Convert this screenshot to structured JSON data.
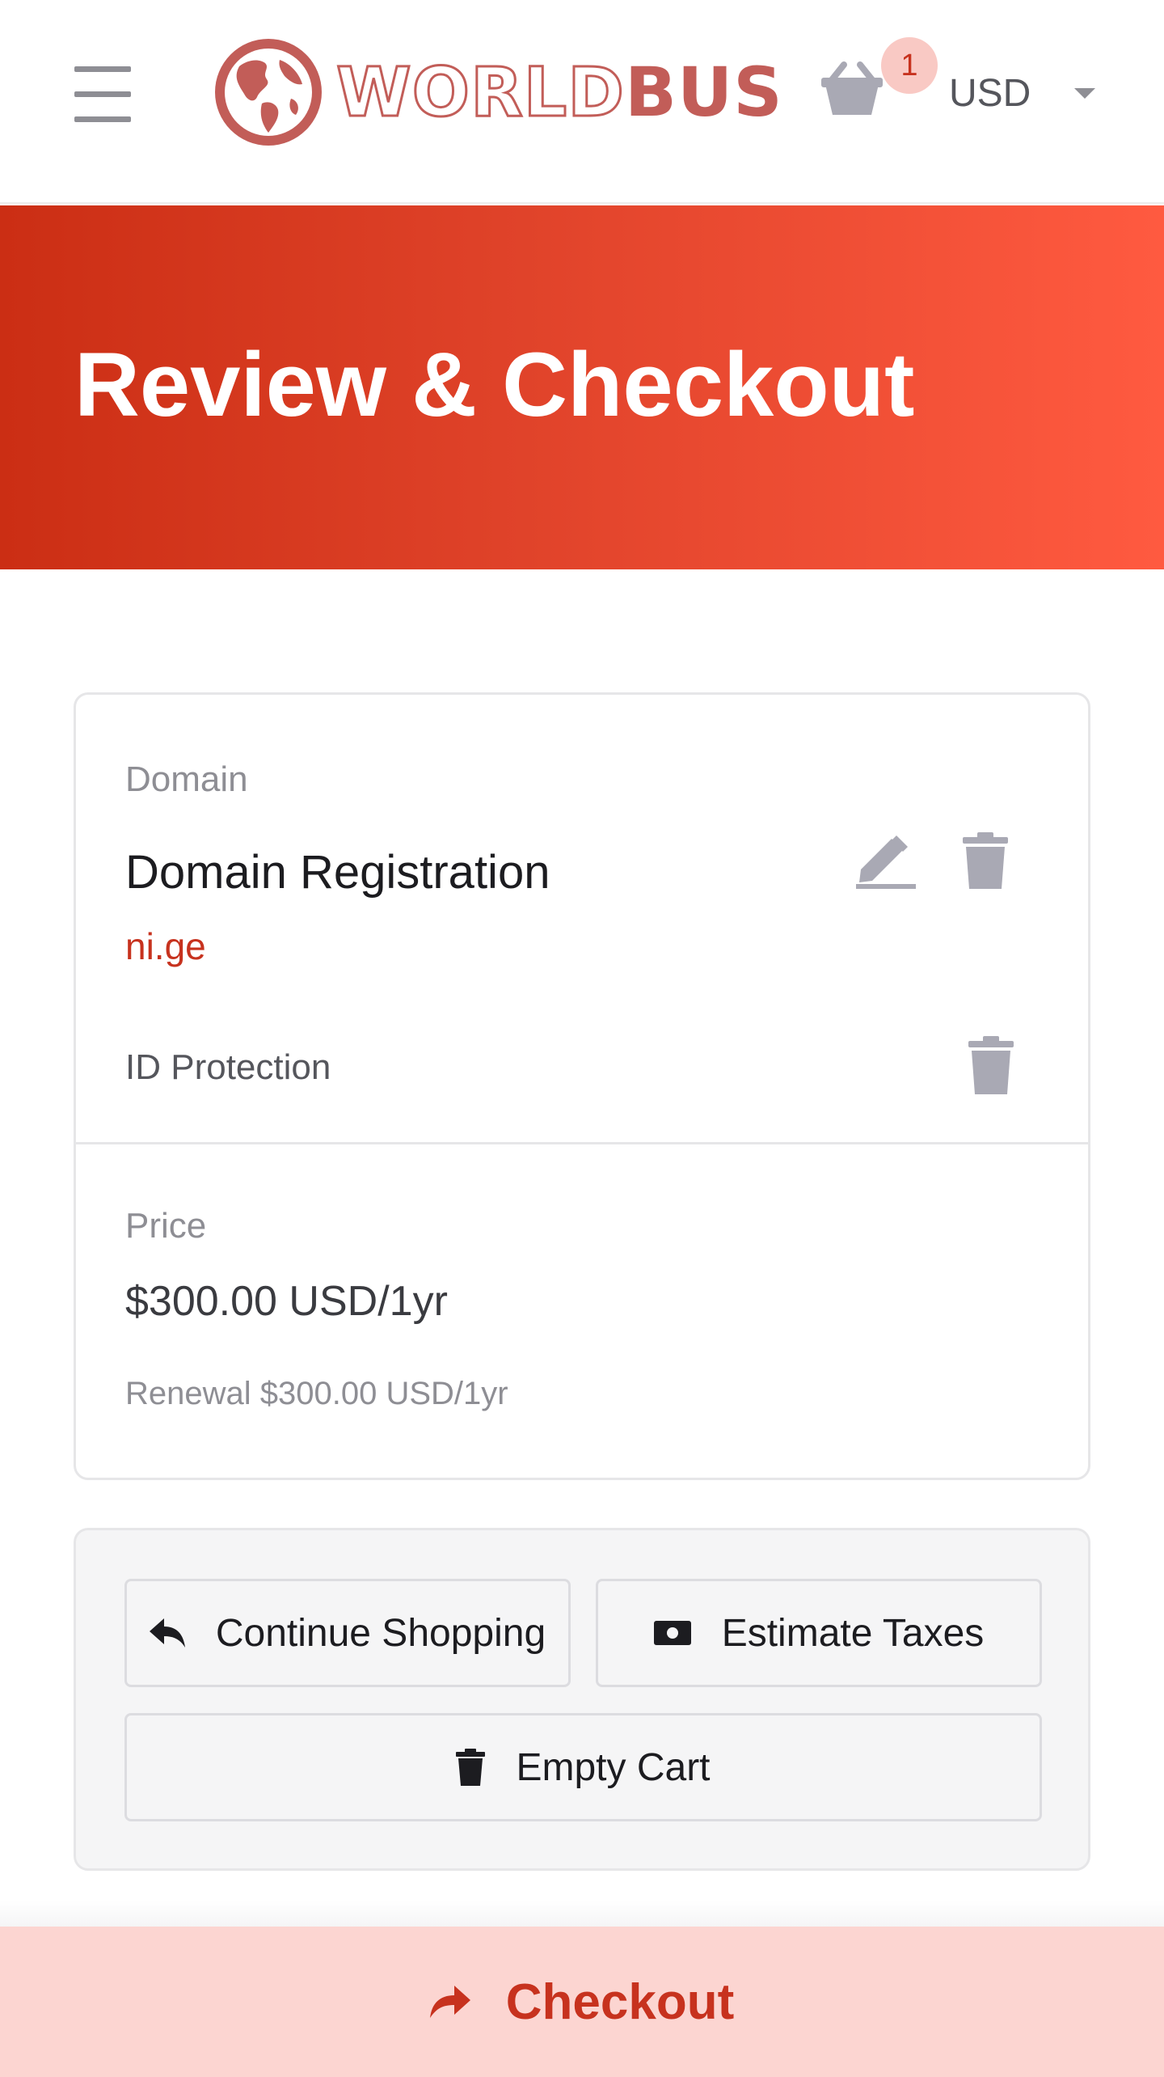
{
  "header": {
    "logo": {
      "word_light": "WORLD",
      "word_bold": "BUS",
      "brand_color": "#c25d58"
    },
    "cart": {
      "icon": "basket-icon",
      "count": "1"
    },
    "currency": {
      "selected": "USD"
    },
    "menu_icon": "hamburger-icon"
  },
  "hero": {
    "title": "Review & Checkout",
    "gradient_colors": [
      "#cb2e14",
      "#ff5a40"
    ]
  },
  "cart_item": {
    "type_label": "Domain",
    "title": "Domain Registration",
    "domain": "ni.ge",
    "edit_icon": "pencil-icon",
    "remove_icon": "trash-icon",
    "addon": {
      "label": "ID Protection",
      "remove_icon": "trash-icon"
    },
    "price_label": "Price",
    "price": "$300.00 USD/1yr",
    "renewal": "Renewal $300.00 USD/1yr"
  },
  "actions": {
    "continue_shopping": {
      "label": "Continue Shopping",
      "icon": "reply-arrow-icon"
    },
    "estimate_taxes": {
      "label": "Estimate Taxes",
      "icon": "money-bill-icon"
    },
    "empty_cart": {
      "label": "Empty Cart",
      "icon": "trash-icon"
    }
  },
  "checkout": {
    "label": "Checkout",
    "icon": "share-arrow-icon",
    "accent": "#c7321e"
  }
}
